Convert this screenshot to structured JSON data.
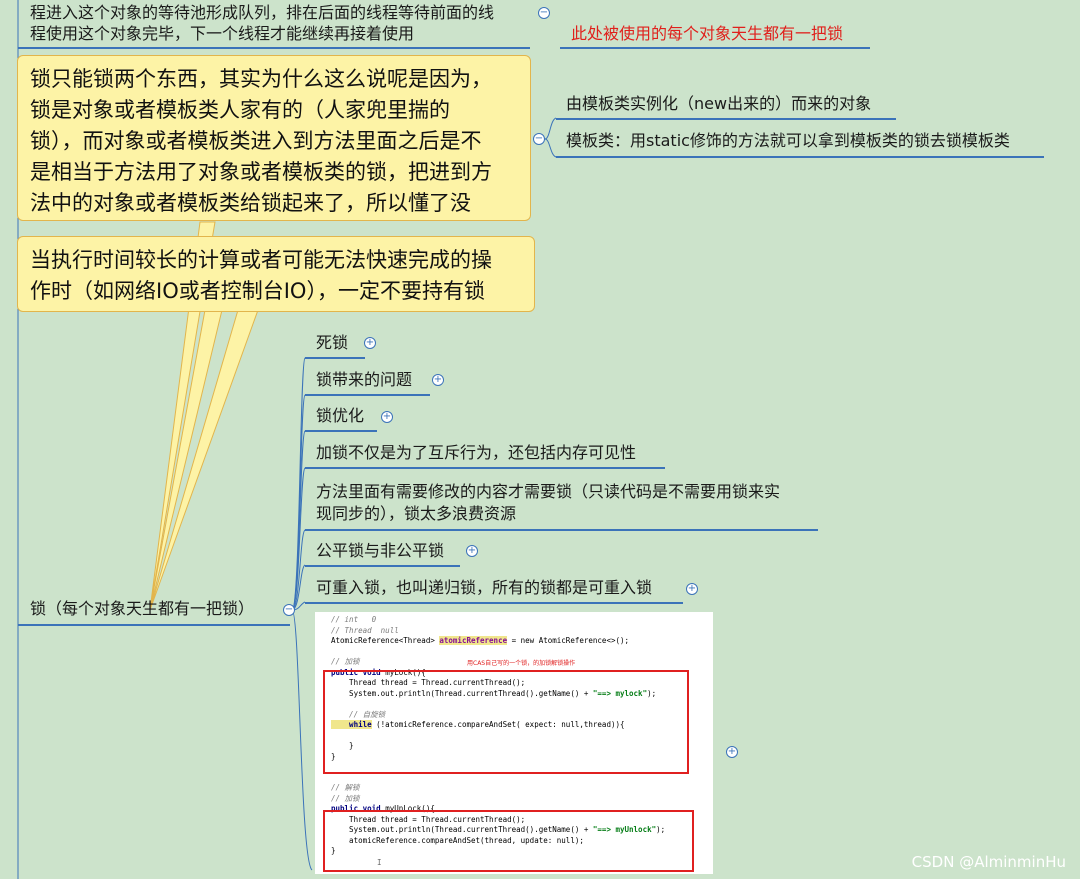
{
  "top_node": {
    "line1": "程进入这个对象的等待池形成队列，排在后面的线程等待前面的线",
    "line2": "程使用这个对象完毕，下一个线程才能继续再接着使用",
    "side_note": "此处被使用的每个对象天生都有一把锁"
  },
  "callouts": [
    {
      "lines": [
        "锁只能锁两个东西，其实为什么这么说呢是因为，",
        "锁是对象或者模板类人家有的（人家兜里揣的",
        "锁），而对象或者模板类进入到方法里面之后是不",
        "是相当于方法用了对象或者模板类的锁，把进到方",
        "法中的对象或者模板类给锁起来了，所以懂了没"
      ]
    },
    {
      "lines": [
        "当执行时间较长的计算或者可能无法快速完成的操",
        "作时（如网络IO或者控制台IO），一定不要持有锁"
      ]
    }
  ],
  "lock_types": [
    "由模板类实例化（new出来的）而来的对象",
    "模板类：用static修饰的方法就可以拿到模板类的锁去锁模板类"
  ],
  "main_node": "锁（每个对象天生都有一把锁）",
  "branches": [
    {
      "label": "死锁",
      "collapsed": true
    },
    {
      "label": "锁带来的问题",
      "collapsed": true
    },
    {
      "label": "锁优化",
      "collapsed": true
    },
    {
      "label": "加锁不仅是为了互斥行为，还包括内存可见性",
      "collapsed": false
    },
    {
      "label": "方法里面有需要修改的内容才需要锁（只读代码是不需要用锁来实",
      "label2": "现同步的），锁太多浪费资源",
      "collapsed": false
    },
    {
      "label": "公平锁与非公平锁",
      "collapsed": true
    },
    {
      "label": "可重入锁，也叫递归锁，所有的锁都是可重入锁",
      "collapsed": true
    }
  ],
  "code": {
    "c1": "// int   0",
    "c2": "// Thread  null",
    "decl_type": "AtomicReference<Thread> ",
    "decl_field": "atomicReference",
    "decl_rest": " = new AtomicReference<>();",
    "c_lock": "// 加锁",
    "note": "用CAS自己写的一个锁，的加锁解锁操作",
    "lock_sig_kw": "public void ",
    "lock_sig_name": "myLock(){",
    "t_line": "    Thread thread = Thread.currentThread();",
    "p_lock_a": "    System.out.println(Thread.currentThread().getName() + ",
    "p_lock_s": "\"==> mylock\"",
    "p_end": ");",
    "c_spin": "    // 自旋锁",
    "while_kw": "    while",
    "while_rest": " (!atomicReference.compareAndSet( expect: null,thread)){",
    "brace_in": "    }",
    "brace": "}",
    "c_unlock": "// 解锁",
    "unlock_sig_name": "myUnLock(){",
    "p_unlock_s": "\"==> myUnlock\"",
    "cas_line": "    atomicReference.compareAndSet(thread, update: null);",
    "cursor": "I"
  },
  "watermark": "CSDN @AlminminHu",
  "colors": {
    "background": "#cce3cb",
    "branch": "#3b73b9",
    "callout": "#fdf3a6",
    "red": "#e0201c"
  }
}
